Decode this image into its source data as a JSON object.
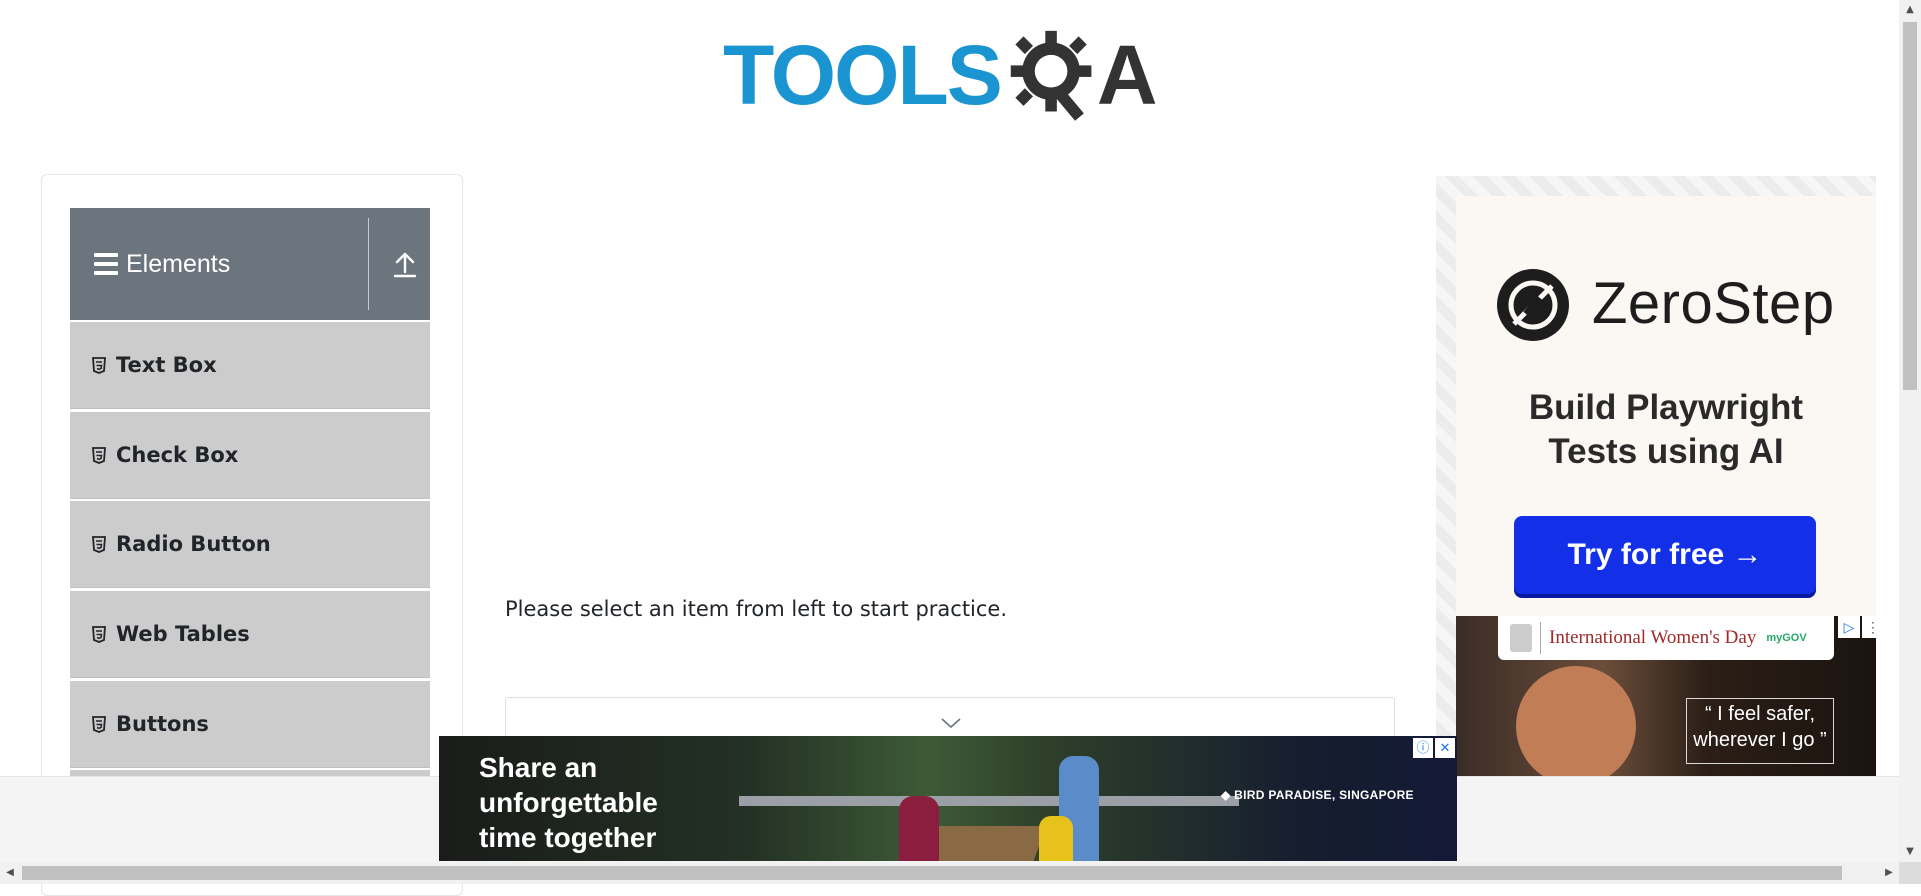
{
  "logo": {
    "part1": "TOOLS",
    "part2": "A"
  },
  "sidebar": {
    "group_title": "Elements",
    "items": [
      {
        "label": "Text Box"
      },
      {
        "label": "Check Box"
      },
      {
        "label": "Radio Button"
      },
      {
        "label": "Web Tables"
      },
      {
        "label": "Buttons"
      }
    ]
  },
  "main": {
    "message": "Please select an item from left to start practice."
  },
  "ad_right": {
    "brand": "ZeroStep",
    "tagline_line1": "Build Playwright",
    "tagline_line2": "Tests using AI",
    "cta": "Try for free →"
  },
  "ad_gov": {
    "title": "International Women's Day",
    "mygov": "myGOV",
    "quote_line1": "“ I feel safer,",
    "quote_line2": "wherever I go ”"
  },
  "ad_bottom": {
    "headline_line1": "Share an",
    "headline_line2": "unforgettable",
    "headline_line3": "time together",
    "place": "BIRD PARADISE, SINGAPORE",
    "info_icon": "ⓘ",
    "close_icon": "✕"
  },
  "colors": {
    "logo_blue": "#1b95d1",
    "header_gray": "#6c757d",
    "item_gray": "#cccccc",
    "cta_blue": "#1330e8"
  }
}
